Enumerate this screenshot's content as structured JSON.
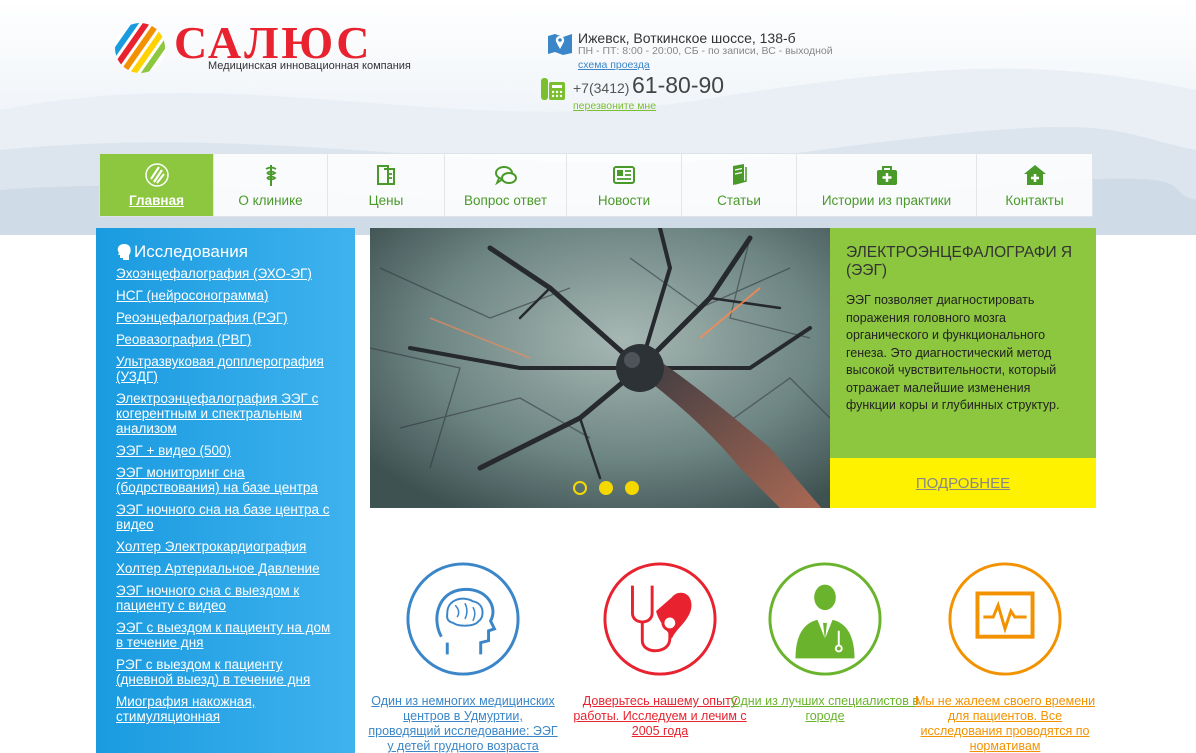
{
  "header": {
    "logo_name": "САЛЮС",
    "logo_tagline": "Медицинская инновационная компания",
    "address": "Ижевск, Воткинское шоссе, 138-б",
    "hours": "ПН - ПТ: 8:00 - 20:00, СБ - по записи, ВС - выходной",
    "route_link": "схема проезда",
    "phone_code": "+7(3412)",
    "phone_number": "61-80-90",
    "callback_link": "перезвоните мне"
  },
  "nav": {
    "items": [
      {
        "label": "Главная",
        "icon": "logo-mark-icon",
        "active": true
      },
      {
        "label": "О клинике",
        "icon": "caduceus-icon"
      },
      {
        "label": "Цены",
        "icon": "price-book-icon"
      },
      {
        "label": "Вопрос ответ",
        "icon": "chat-bubbles-icon"
      },
      {
        "label": "Новости",
        "icon": "newspaper-icon"
      },
      {
        "label": "Статьи",
        "icon": "article-book-icon"
      },
      {
        "label": "Истории из практики",
        "icon": "medical-case-icon"
      },
      {
        "label": "Контакты",
        "icon": "home-plus-icon"
      }
    ]
  },
  "sidebar": {
    "title": "Исследования",
    "items": [
      "Эхоэнцефалография (ЭХО-ЭГ)",
      "НСГ (нейросонограмма)",
      "Реоэнцефалография (РЭГ)",
      "Реовазография (РВГ)",
      "Ультразвуковая допплерография (УЗДГ)",
      "Электроэнцефалография ЭЭГ с когерентным и спектральным анализом",
      "ЭЭГ + видео (500)",
      "ЭЭГ мониторинг сна (бодрствования) на базе центра",
      "ЭЭГ ночного сна на базе центра с видео",
      "Холтер Электрокардиография",
      "Холтер Артериальное Давление",
      "ЭЭГ ночного сна с выездом к пациенту с видео",
      "ЭЭГ с выездом к пациенту на дом в течение дня",
      "РЭГ с выездом к пациенту (дневной выезд) в течение дня",
      "Миография накожная, стимуляционная"
    ]
  },
  "slider": {
    "title": "ЭЛЕКТРОЭНЦЕФАЛОГРАФИ Я (ЭЭГ)",
    "text": "ЭЭГ позволяет диагностировать поражения головного мозга органического и функционального генеза. Это диагностический метод высокой чувствительности, который отражает малейшие изменения функции коры и глубинных структур.",
    "more_label": "ПОДРОБНЕЕ",
    "dots_count": 3,
    "active_dot": 0
  },
  "features": [
    {
      "text": "Один из немногих медицинских центров в Удмуртии, проводящий исследование: ЭЭГ у детей грудного возраста",
      "color": "#3a86c8",
      "icon": "brain-head-icon"
    },
    {
      "text": "Доверьтесь нашему опыту работы. Исследуем и лечим с 2005 года",
      "color": "#e8232f",
      "icon": "heart-stethoscope-icon"
    },
    {
      "text": "Одни из лучших специалистов в городе",
      "color": "#6ab42d",
      "icon": "doctor-icon"
    },
    {
      "text": "Мы не жалеем своего времени для пациентов. Все исследования проводятся по нормативам",
      "color": "#f39200",
      "icon": "monitor-pulse-icon"
    }
  ],
  "colors": {
    "brand_red": "#e8232f",
    "brand_green": "#8dc63f",
    "sidebar_blue": "#1a9be0",
    "accent_yellow": "#fff200",
    "link_blue": "#3a86c8"
  }
}
